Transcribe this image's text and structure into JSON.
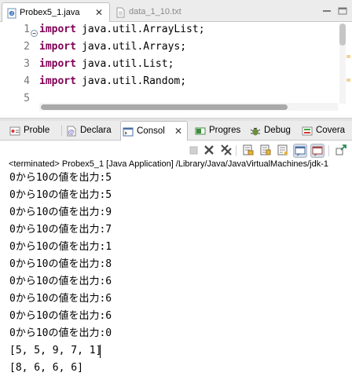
{
  "editor": {
    "tabs": [
      {
        "label": "Probex5_1.java",
        "active": true
      },
      {
        "label": "data_1_10.txt",
        "active": false
      }
    ],
    "lines": [
      {
        "number": "1",
        "keyword": "import",
        "text": "java.util.ArrayList;"
      },
      {
        "number": "2",
        "keyword": "import",
        "text": "java.util.Arrays;"
      },
      {
        "number": "3",
        "keyword": "import",
        "text": "java.util.List;"
      },
      {
        "number": "4",
        "keyword": "import",
        "text": "java.util.Random;"
      },
      {
        "number": "5",
        "keyword": "",
        "text": ""
      }
    ]
  },
  "views": {
    "tabs": [
      {
        "label": "Proble",
        "icon": "problems-icon"
      },
      {
        "label": "Declara",
        "icon": "declaration-icon"
      },
      {
        "label": "Consol",
        "icon": "console-icon",
        "active": true
      },
      {
        "label": "Progres",
        "icon": "progress-icon"
      },
      {
        "label": "Debug",
        "icon": "debug-icon"
      },
      {
        "label": "Covera",
        "icon": "coverage-icon"
      }
    ]
  },
  "console": {
    "status": "<terminated> Probex5_1 [Java Application] /Library/Java/JavaVirtualMachines/jdk-1",
    "output": [
      "0から10の値を出力:5",
      "0から10の値を出力:5",
      "0から10の値を出力:9",
      "0から10の値を出力:7",
      "0から10の値を出力:1",
      "0から10の値を出力:8",
      "0から10の値を出力:6",
      "0から10の値を出力:6",
      "0から10の値を出力:6",
      "0から10の値を出力:0",
      "[5, 5, 9, 7, 1]",
      "[8, 6, 6, 6]"
    ]
  },
  "colors": {
    "keyword": "#7f0055",
    "line_number": "#787878",
    "tab_bar": "#ececec"
  }
}
